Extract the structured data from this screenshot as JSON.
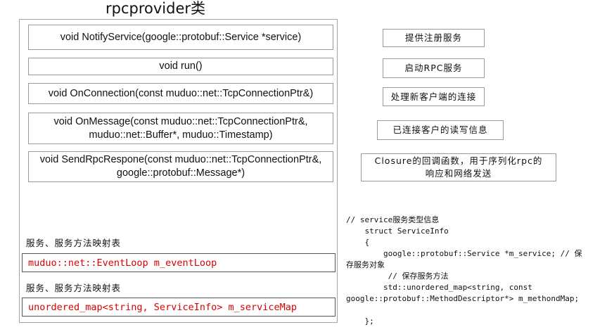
{
  "title": "rpcprovider类",
  "methods": [
    {
      "line1": "void NotifyService(google::protobuf::Service *service)",
      "line2": ""
    },
    {
      "line1": "void run()",
      "line2": ""
    },
    {
      "line1": "void OnConnection(const muduo::net::TcpConnectionPtr&)",
      "line2": ""
    },
    {
      "line1": "void OnMessage(const muduo::net::TcpConnectionPtr&,",
      "line2": "muduo::net::Buffer*, muduo::Timestamp)"
    },
    {
      "line1": "void SendRpcRespone(const muduo::net::TcpConnectionPtr&,",
      "line2": "google::protobuf::Message*)"
    }
  ],
  "comments": [
    {
      "line1": "提供注册服务",
      "line2": ""
    },
    {
      "line1": "启动RPC服务",
      "line2": ""
    },
    {
      "line1": "处理新客户端的连接",
      "line2": ""
    },
    {
      "line1": "已连接客户的读写信息",
      "line2": ""
    },
    {
      "line1": "Closure的回调函数，用于序列化rpc的",
      "line2": "响应和网络发送"
    }
  ],
  "members": [
    {
      "label": "服务、服务方法映射表",
      "code": "muduo::net::EventLoop m_eventLoop"
    },
    {
      "label": "服务、服务方法映射表",
      "code": "unordered_map<string, ServiceInfo> m_serviceMap"
    }
  ],
  "code_lines": [
    "// service服务类型信息",
    "    struct ServiceInfo",
    "    {",
    "        google::protobuf::Service *m_service; // 保",
    "存服务对象",
    "         // 保存服务方法",
    "        std::unordered_map<string, const",
    "google::protobuf::MethodDescriptor*> m_methondMap;",
    "",
    "    };"
  ]
}
